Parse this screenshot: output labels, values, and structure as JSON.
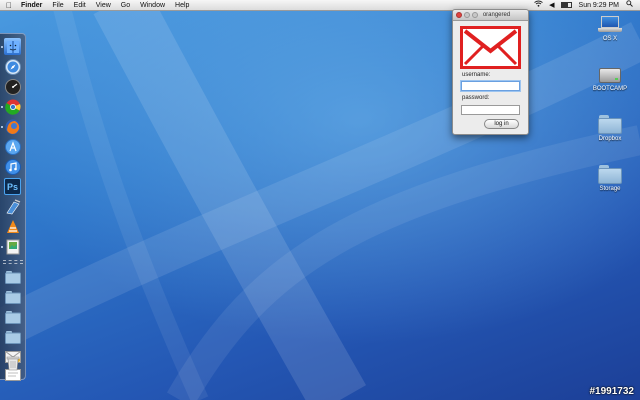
{
  "menubar": {
    "apple_icon": "apple-icon",
    "items": [
      "Finder",
      "File",
      "Edit",
      "View",
      "Go",
      "Window",
      "Help"
    ],
    "clock": "Sun 9:29 PM",
    "battery_level": 0.7,
    "tray_icons": [
      "wifi-icon",
      "volume-icon",
      "battery-icon",
      "search-icon"
    ]
  },
  "dock": {
    "icons": [
      "finder-icon",
      "safari-icon",
      "dashboard-icon",
      "chrome-icon",
      "firefox-icon",
      "app-store-icon",
      "itunes-icon",
      "photoshop-icon",
      "xcode-icon",
      "vlc-icon",
      "preview-icon",
      "folder-icon",
      "folder-icon",
      "folder-icon",
      "folder-icon",
      "mail-icon",
      "notes-icon",
      "trash-icon"
    ],
    "photoshop_label": "Ps"
  },
  "desktop_icons": [
    {
      "label": "OS X",
      "icon": "laptop-icon"
    },
    {
      "label": "BOOTCAMP",
      "icon": "hard-drive-icon"
    },
    {
      "label": "Dropbox",
      "icon": "folder-icon"
    },
    {
      "label": "Storage",
      "icon": "folder-icon"
    }
  ],
  "window": {
    "title": "orangered",
    "username_label": "username:",
    "username_value": "",
    "password_label": "password:",
    "password_value": "",
    "login_label": "log in",
    "logo_icon": "envelope-icon"
  },
  "colors": {
    "logo_red": "#e02020",
    "desktop_blue": "#2f79cc",
    "close_button": "#e0443e"
  },
  "watermark": "#1991732"
}
